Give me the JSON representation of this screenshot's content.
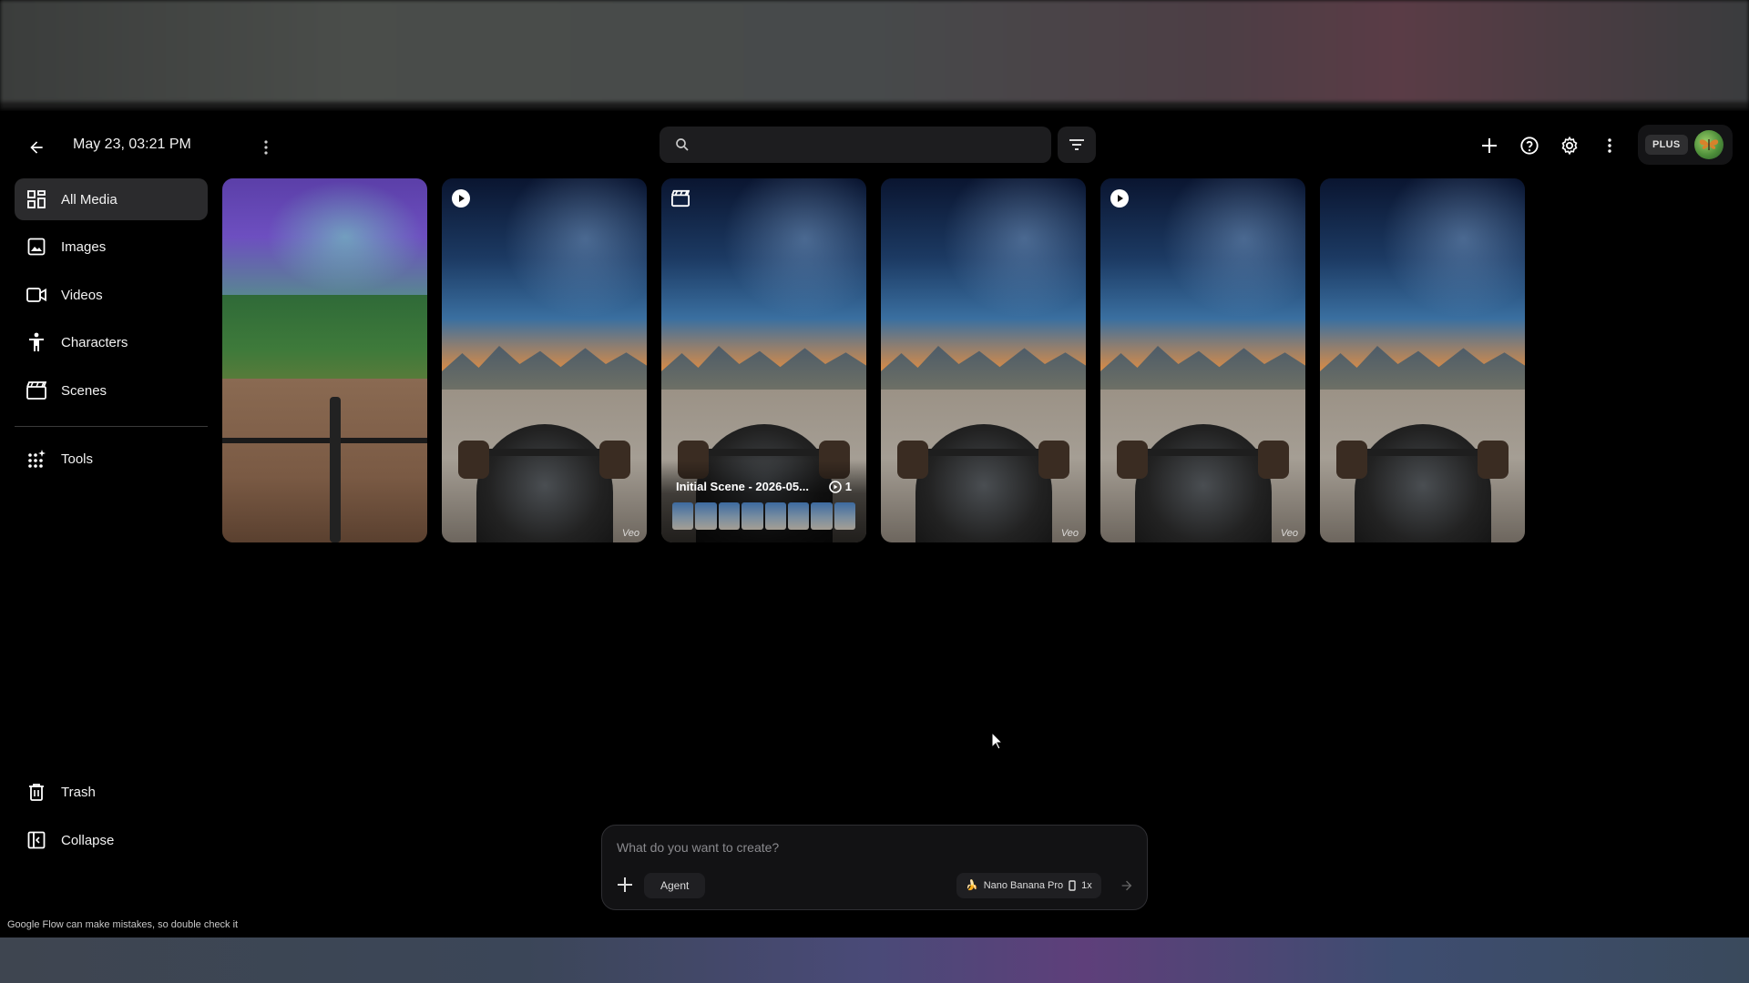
{
  "header": {
    "project_title": "May 23, 03:21 PM",
    "search": {
      "value": "",
      "placeholder": ""
    },
    "plan_badge": "PLUS"
  },
  "sidebar": {
    "items": [
      {
        "label": "All Media",
        "icon": "grid-icon",
        "active": true
      },
      {
        "label": "Images",
        "icon": "image-icon"
      },
      {
        "label": "Videos",
        "icon": "video-icon"
      },
      {
        "label": "Characters",
        "icon": "person-icon"
      },
      {
        "label": "Scenes",
        "icon": "clapperboard-icon"
      },
      {
        "label": "Tools",
        "icon": "sparkle-grid-icon"
      }
    ],
    "bottom_items": [
      {
        "label": "Trash",
        "icon": "trash-icon"
      },
      {
        "label": "Collapse",
        "icon": "collapse-icon"
      }
    ]
  },
  "media": [
    {
      "kind": "image",
      "subject": "mountain-bike-trail"
    },
    {
      "kind": "video",
      "tag": "Veo"
    },
    {
      "kind": "scene",
      "title": "Initial Scene - 2026-05...",
      "count": "1"
    },
    {
      "kind": "image",
      "tag": "Veo"
    },
    {
      "kind": "video",
      "tag": "Veo"
    },
    {
      "kind": "image"
    }
  ],
  "composer": {
    "placeholder": "What do you want to create?",
    "agent_label": "Agent",
    "model_label": "Nano Banana Pro",
    "multiplier": "1x"
  },
  "footer_note": "Google Flow can make mistakes, so double check it",
  "colors": {
    "background": "#000000",
    "surface": "#1d1d1f",
    "active_nav": "#2b2b2d"
  }
}
